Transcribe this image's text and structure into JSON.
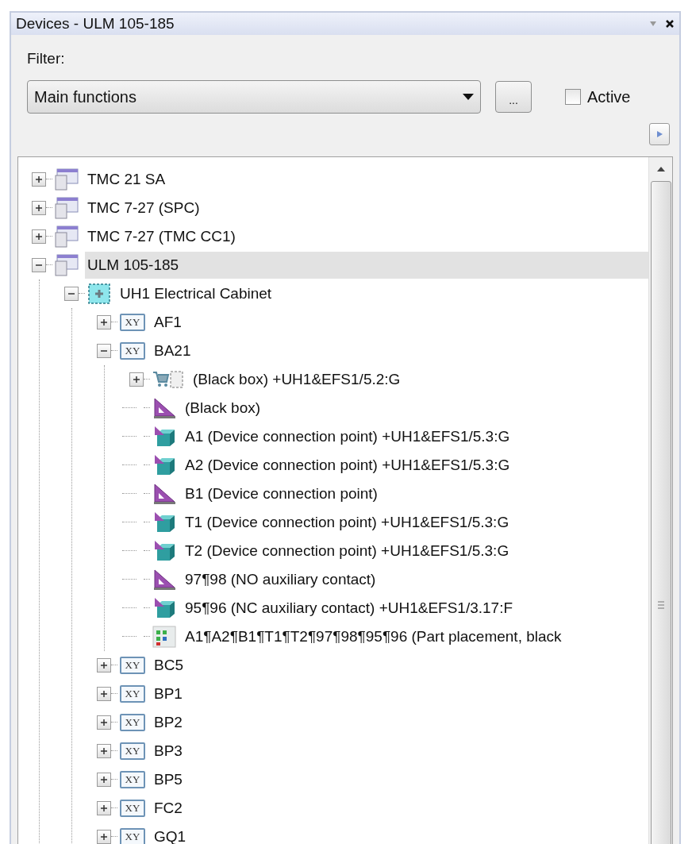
{
  "panel": {
    "title": "Devices - ULM 105-185"
  },
  "filter": {
    "label": "Filter:",
    "value": "Main functions",
    "more_button": "...",
    "active": {
      "label": "Active",
      "checked": false
    }
  },
  "tree": [
    {
      "label": "TMC 21 SA",
      "kind": "device",
      "expanded": false,
      "selected": false
    },
    {
      "label": "TMC 7-27 (SPC)",
      "kind": "device",
      "expanded": false,
      "selected": false
    },
    {
      "label": "TMC 7-27 (TMC CC1)",
      "kind": "device",
      "expanded": false,
      "selected": false
    },
    {
      "label": "ULM 105-185",
      "kind": "device",
      "expanded": true,
      "selected": true,
      "children": [
        {
          "label": "UH1 Electrical Cabinet",
          "kind": "cabinet",
          "expanded": true,
          "selected": false,
          "children": [
            {
              "label": "AF1",
              "kind": "xy",
              "icon_label": "XY",
              "expanded": false,
              "selected": false
            },
            {
              "label": "BA21",
              "kind": "xy",
              "icon_label": "XY",
              "expanded": true,
              "selected": false,
              "children": [
                {
                  "label": "(Black box) +UH1&EFS1/5.2:G",
                  "kind": "cart",
                  "expanded": false,
                  "selected": false
                },
                {
                  "label": "(Black box)",
                  "kind": "ruler",
                  "selected": false
                },
                {
                  "label": "A1 (Device connection point) +UH1&EFS1/5.3:G",
                  "kind": "cube",
                  "selected": false
                },
                {
                  "label": "A2 (Device connection point) +UH1&EFS1/5.3:G",
                  "kind": "cube",
                  "selected": false
                },
                {
                  "label": "B1 (Device connection point)",
                  "kind": "ruler",
                  "selected": false
                },
                {
                  "label": "T1 (Device connection point) +UH1&EFS1/5.3:G",
                  "kind": "cube",
                  "selected": false
                },
                {
                  "label": "T2 (Device connection point) +UH1&EFS1/5.3:G",
                  "kind": "cube",
                  "selected": false
                },
                {
                  "label": "97¶98 (NO auxiliary contact)",
                  "kind": "ruler",
                  "selected": false
                },
                {
                  "label": "95¶96 (NC auxiliary contact) +UH1&EFS1/3.17:F",
                  "kind": "cube",
                  "selected": false
                },
                {
                  "label": "A1¶A2¶B1¶T1¶T2¶97¶98¶95¶96 (Part placement, black",
                  "kind": "placement",
                  "selected": false
                }
              ]
            },
            {
              "label": "BC5",
              "kind": "xy",
              "icon_label": "XY",
              "expanded": false,
              "selected": false
            },
            {
              "label": "BP1",
              "kind": "xy",
              "icon_label": "XY",
              "expanded": false,
              "selected": false
            },
            {
              "label": "BP2",
              "kind": "xy",
              "icon_label": "XY",
              "expanded": false,
              "selected": false
            },
            {
              "label": "BP3",
              "kind": "xy",
              "icon_label": "XY",
              "expanded": false,
              "selected": false
            },
            {
              "label": "BP5",
              "kind": "xy",
              "icon_label": "XY",
              "expanded": false,
              "selected": false
            },
            {
              "label": "FC2",
              "kind": "xy",
              "icon_label": "XY",
              "expanded": false,
              "selected": false
            },
            {
              "label": "GQ1",
              "kind": "xy",
              "icon_label": "XY",
              "expanded": false,
              "selected": false
            }
          ]
        }
      ]
    }
  ]
}
